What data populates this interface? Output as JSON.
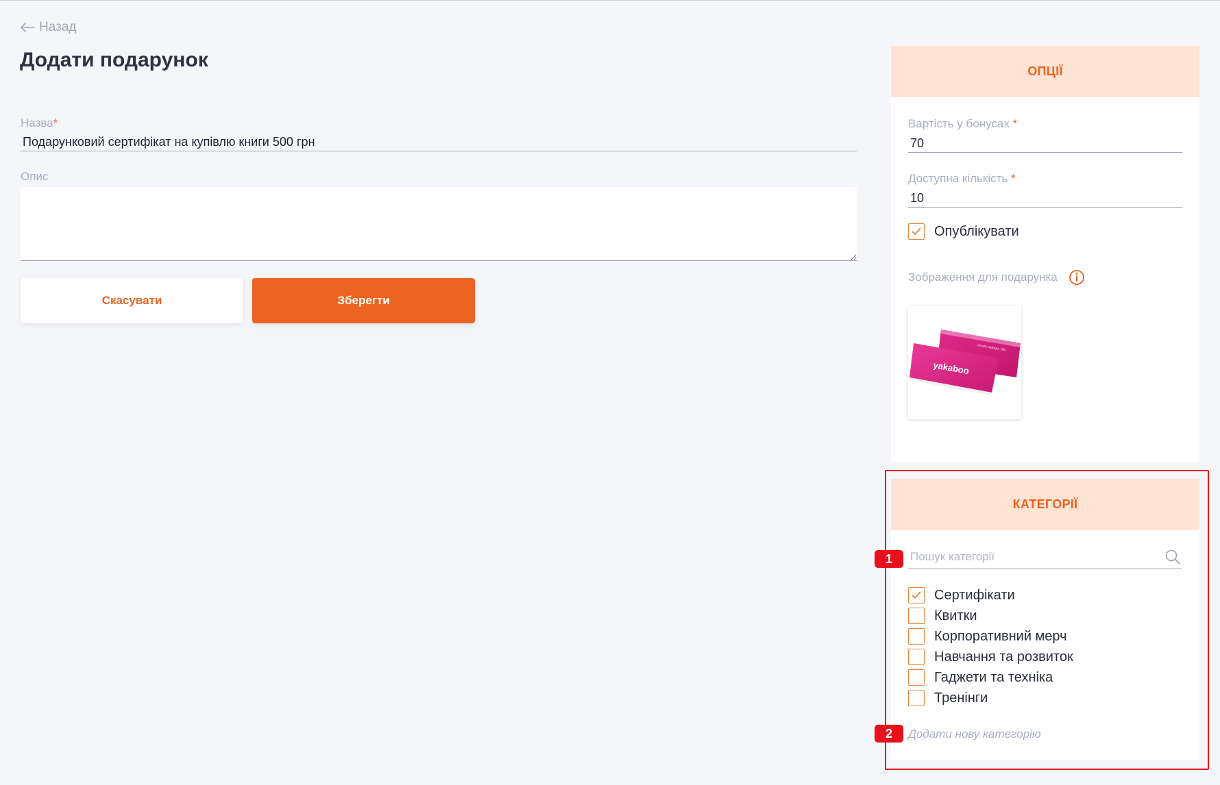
{
  "header": {
    "back_label": "Назад",
    "title": "Додати подарунок"
  },
  "form": {
    "name_label": "Назва",
    "name_required_mark": "*",
    "name_value": "Подарунковий сертифікат на купівлю книги 500 грн",
    "description_label": "Опис",
    "description_value": "",
    "cancel_label": "Скасувати",
    "save_label": "Зберегти"
  },
  "options": {
    "title": "ОПЦІЇ",
    "cost_label": "Вартість у бонусах",
    "cost_value": "70",
    "quantity_label": "Доступна кількість",
    "quantity_value": "10",
    "required_mark": "*",
    "publish_label": "Опублікувати",
    "publish_checked": true,
    "image_label": "Зображення для подарунка",
    "image_brand": "yakaboo",
    "image_tagline": "читати завжди ОК!"
  },
  "categories": {
    "title": "КАТЕГОРІЇ",
    "search_placeholder": "Пошук категорії",
    "items": [
      {
        "label": "Сертифікати",
        "checked": true
      },
      {
        "label": "Квитки",
        "checked": false
      },
      {
        "label": "Корпоративний мерч",
        "checked": false
      },
      {
        "label": "Навчання та розвиток",
        "checked": false
      },
      {
        "label": "Гаджети та техніка",
        "checked": false
      },
      {
        "label": "Тренінги",
        "checked": false
      }
    ],
    "add_label": "Додати нову категорію"
  },
  "annotations": {
    "badge_1": "1",
    "badge_2": "2"
  },
  "colors": {
    "accent": "#ec6422",
    "panel_header_bg": "#ffe3d3",
    "highlight": "#e8101a"
  }
}
